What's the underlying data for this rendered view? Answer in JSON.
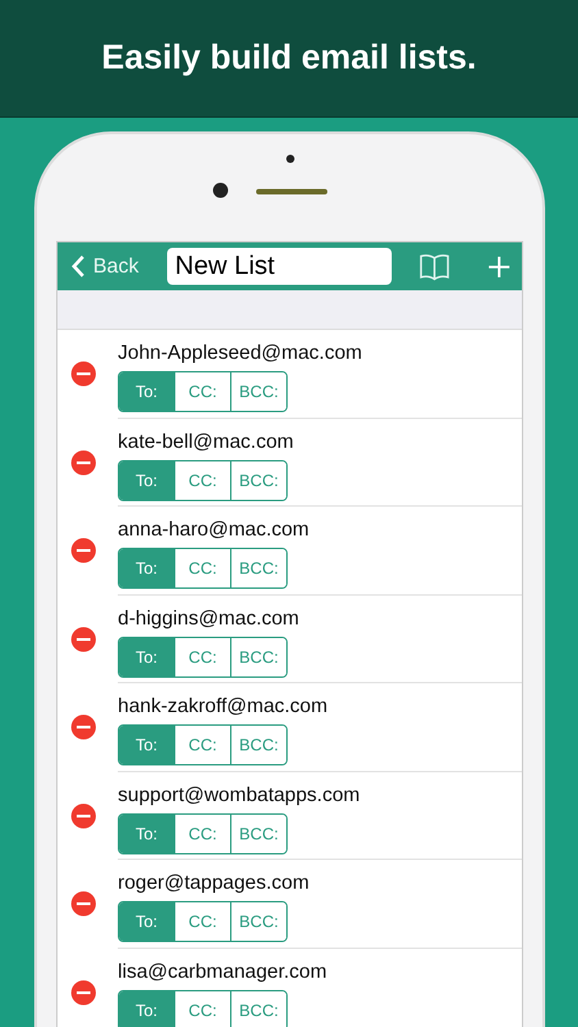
{
  "banner": {
    "title": "Easily build email lists."
  },
  "nav": {
    "back": "Back",
    "list_name": "New List"
  },
  "rows": [
    {
      "email": "John-Appleseed@mac.com",
      "fields": [
        {
          "label": "To:",
          "selected": true
        },
        {
          "label": "CC:",
          "selected": false
        },
        {
          "label": "BCC:",
          "selected": false
        }
      ]
    },
    {
      "email": "kate-bell@mac.com",
      "fields": [
        {
          "label": "To:",
          "selected": true
        },
        {
          "label": "CC:",
          "selected": false
        },
        {
          "label": "BCC:",
          "selected": false
        }
      ]
    },
    {
      "email": "anna-haro@mac.com",
      "fields": [
        {
          "label": "To:",
          "selected": true
        },
        {
          "label": "CC:",
          "selected": false
        },
        {
          "label": "BCC:",
          "selected": false
        }
      ]
    },
    {
      "email": "d-higgins@mac.com",
      "fields": [
        {
          "label": "To:",
          "selected": true
        },
        {
          "label": "CC:",
          "selected": false
        },
        {
          "label": "BCC:",
          "selected": false
        }
      ]
    },
    {
      "email": "hank-zakroff@mac.com",
      "fields": [
        {
          "label": "To:",
          "selected": true
        },
        {
          "label": "CC:",
          "selected": false
        },
        {
          "label": "BCC:",
          "selected": false
        }
      ]
    },
    {
      "email": "support@wombatapps.com",
      "fields": [
        {
          "label": "To:",
          "selected": true
        },
        {
          "label": "CC:",
          "selected": false
        },
        {
          "label": "BCC:",
          "selected": false
        }
      ]
    },
    {
      "email": "roger@tappages.com",
      "fields": [
        {
          "label": "To:",
          "selected": true
        },
        {
          "label": "CC:",
          "selected": false
        },
        {
          "label": "BCC:",
          "selected": false
        }
      ]
    },
    {
      "email": "lisa@carbmanager.com",
      "fields": [
        {
          "label": "To:",
          "selected": true
        },
        {
          "label": "CC:",
          "selected": false
        },
        {
          "label": "BCC:",
          "selected": false
        }
      ]
    }
  ]
}
